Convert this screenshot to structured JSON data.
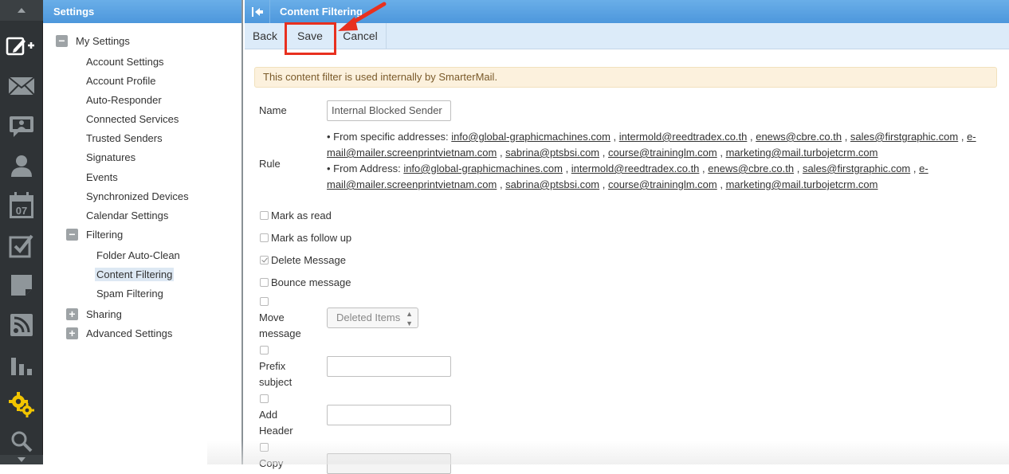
{
  "rail": {
    "icons": [
      "compose-icon",
      "mail-icon",
      "chat-icon",
      "contacts-icon",
      "calendar-icon",
      "tasks-icon",
      "notes-icon",
      "rss-icon",
      "reports-icon",
      "settings-icon",
      "search-icon"
    ],
    "calendar_day": "07",
    "active_color": "#f2c500"
  },
  "tree": {
    "header": "Settings",
    "my_settings": "My Settings",
    "items": {
      "account_settings": "Account Settings",
      "account_profile": "Account Profile",
      "auto_responder": "Auto-Responder",
      "connected_services": "Connected Services",
      "trusted_senders": "Trusted Senders",
      "signatures": "Signatures",
      "events": "Events",
      "synchronized_devices": "Synchronized Devices",
      "calendar_settings": "Calendar Settings",
      "filtering": "Filtering",
      "folder_auto_clean": "Folder Auto-Clean",
      "content_filtering": "Content Filtering",
      "spam_filtering": "Spam Filtering",
      "sharing": "Sharing",
      "advanced_settings": "Advanced Settings"
    },
    "collapse_symbol": "−",
    "expand_symbol": "+"
  },
  "main": {
    "title": "Content Filtering",
    "toolbar": {
      "back": "Back",
      "save": "Save",
      "cancel": "Cancel"
    },
    "notice": "This content filter is used internally by SmarterMail.",
    "name_label": "Name",
    "name_value": "Internal Blocked Sender",
    "rule_label": "Rule",
    "rule1": {
      "prefix": "• From specific addresses: ",
      "line1": [
        "info@global-graphicmachines.com",
        "intermold@reedtradex.co.th",
        "enews@cbre.co.th",
        "sales@firstgraphic.com",
        "e-"
      ],
      "line2": [
        "mail@mailer.screenprintvietnam.com",
        "sabrina@ptsbsi.com",
        "course@traininglm.com",
        "marketing@mail.turbojetcrm.com"
      ]
    },
    "rule2": {
      "prefix": "• From Address: ",
      "line1": [
        "info@global-graphicmachines.com",
        "intermold@reedtradex.co.th",
        "enews@cbre.co.th",
        "sales@firstgraphic.com",
        "e-"
      ],
      "line2": [
        "mail@mailer.screenprintvietnam.com",
        "sabrina@ptsbsi.com",
        "course@traininglm.com",
        "marketing@mail.turbojetcrm.com"
      ]
    },
    "actions": {
      "mark_read": "Mark as read",
      "mark_followup": "Mark as follow up",
      "delete_message": "Delete Message",
      "bounce_message": "Bounce message",
      "move_label_1": "Move",
      "move_label_2": "message",
      "move_folder": "Deleted Items",
      "prefix_label_1": "Prefix",
      "prefix_label_2": "subject",
      "header_label_1": "Add",
      "header_label_2": "Header",
      "copy_label_1": "Copy"
    },
    "checked": {
      "delete_message": true
    },
    "select_arrows": "▲▼"
  },
  "annotation": {
    "color": "#e8301f",
    "highlighted": "save-button"
  }
}
